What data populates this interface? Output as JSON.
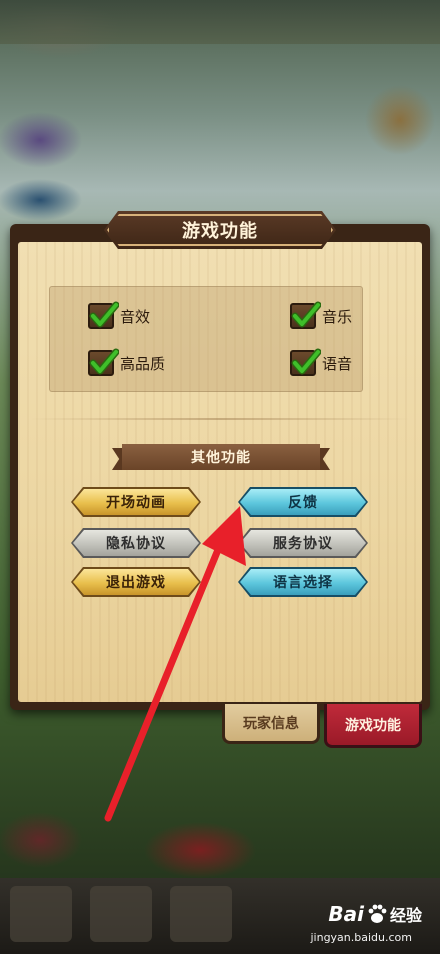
{
  "dialog": {
    "title": "游戏功能",
    "settings": [
      {
        "label": "音效",
        "checked": true
      },
      {
        "label": "音乐",
        "checked": true
      },
      {
        "label": "高品质",
        "checked": true
      },
      {
        "label": "语音",
        "checked": true
      }
    ],
    "section_title": "其他功能",
    "buttons": {
      "opening_animation": "开场动画",
      "feedback": "反馈",
      "privacy_policy": "隐私协议",
      "service_agreement": "服务协议",
      "exit_game": "退出游戏",
      "language_select": "语言选择"
    },
    "tabs": {
      "player_info": "玩家信息",
      "game_functions": "游戏功能",
      "active": "game_functions"
    }
  },
  "watermark": {
    "brand": "Bai",
    "brand_suffix": "经验",
    "url": "jingyan.baidu.com"
  },
  "colors": {
    "gold_button": "#e8bf4c",
    "grey_button": "#c2c2bb",
    "blue_button": "#5cc6dc",
    "active_tab": "#c02a3a",
    "annotation_arrow": "#e8202a",
    "checkmark": "#3fbf2a"
  }
}
